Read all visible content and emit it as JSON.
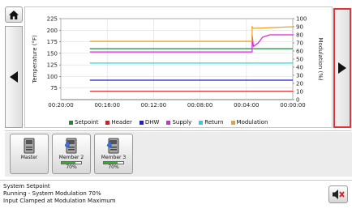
{
  "nav": {
    "home_icon": "home-icon",
    "prev_icon": "triangle-left-icon",
    "next_icon": "triangle-right-icon"
  },
  "chart_data": {
    "type": "line",
    "x_ticks": [
      "00:20:00",
      "00:16:00",
      "00:12:00",
      "00:08:00",
      "00:04:00",
      "00:00:00"
    ],
    "ylabel": "Temperature (°F)",
    "y2label": "Modulation (%)",
    "ylim": [
      50,
      225
    ],
    "y_ticks": [
      75,
      100,
      125,
      150,
      175,
      200,
      225
    ],
    "y2lim": [
      0,
      100
    ],
    "y2_ticks": [
      0,
      10,
      20,
      30,
      40,
      50,
      60,
      70,
      80,
      90,
      100
    ],
    "grid": true,
    "legend_position": "bottom",
    "series": [
      {
        "name": "Setpoint",
        "color": "#1a8a3a",
        "axis": "left",
        "values": [
          [
            -17.5,
            160
          ],
          [
            0,
            160
          ]
        ]
      },
      {
        "name": "Header",
        "color": "#d22020",
        "axis": "left",
        "values": [
          [
            -17.5,
            68
          ],
          [
            0,
            68
          ]
        ]
      },
      {
        "name": "DHW",
        "color": "#2020c8",
        "axis": "left",
        "values": [
          [
            -17.5,
            92
          ],
          [
            0,
            92
          ]
        ]
      },
      {
        "name": "Supply",
        "color": "#e020e0",
        "axis": "left",
        "values": [
          [
            -17.5,
            153
          ],
          [
            -3.5,
            153
          ],
          [
            -3.5,
            190
          ],
          [
            -3.4,
            165
          ],
          [
            -3.0,
            172
          ],
          [
            -2.6,
            185
          ],
          [
            -2.0,
            190
          ],
          [
            0,
            190
          ]
        ]
      },
      {
        "name": "Return",
        "color": "#20d8d8",
        "axis": "left",
        "values": [
          [
            -17.5,
            129
          ],
          [
            0,
            129
          ]
        ]
      },
      {
        "name": "Modulation",
        "color": "#f0a020",
        "axis": "right",
        "values": [
          [
            -17.5,
            72
          ],
          [
            -3.5,
            72
          ],
          [
            -3.5,
            90
          ],
          [
            -3.4,
            88
          ],
          [
            0,
            90
          ]
        ]
      }
    ]
  },
  "members": [
    {
      "label": "Master",
      "has_bar": false,
      "modulation": null,
      "pct_text": ""
    },
    {
      "label": "Member 2",
      "has_bar": true,
      "modulation": 70,
      "pct_text": "70%"
    },
    {
      "label": "Member 3",
      "has_bar": true,
      "modulation": 70,
      "pct_text": "70%"
    }
  ],
  "status": {
    "line1": "System Setpoint",
    "line2": "Running - System Modulation 70%",
    "line3": "Input Clamped at Modulation Maximum"
  },
  "mute_icon": "speaker-mute-icon"
}
